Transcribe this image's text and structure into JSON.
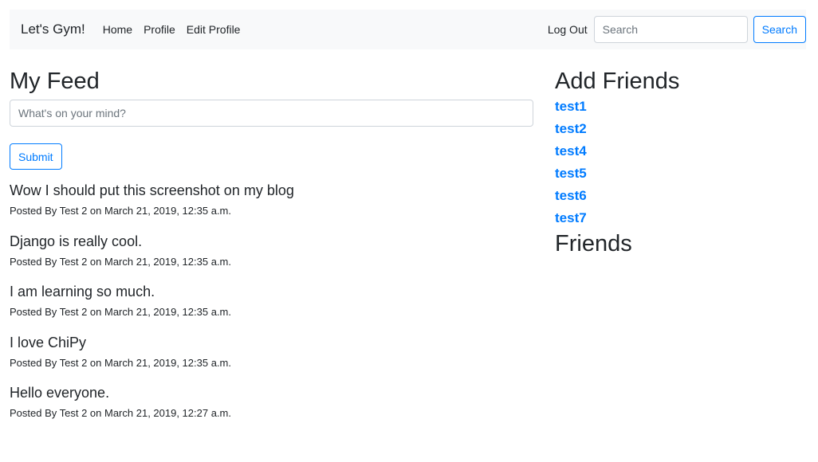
{
  "navbar": {
    "brand": "Let's Gym!",
    "links": [
      "Home",
      "Profile",
      "Edit Profile"
    ],
    "logout": "Log Out",
    "search_placeholder": "Search",
    "search_button": "Search"
  },
  "feed": {
    "title": "My Feed",
    "input_placeholder": "What's on your mind?",
    "submit_label": "Submit",
    "posts": [
      {
        "title": "Wow I should put this screenshot on my blog",
        "meta": "Posted By Test 2 on March 21, 2019, 12:35 a.m."
      },
      {
        "title": "Django is really cool.",
        "meta": "Posted By Test 2 on March 21, 2019, 12:35 a.m."
      },
      {
        "title": "I am learning so much.",
        "meta": "Posted By Test 2 on March 21, 2019, 12:35 a.m."
      },
      {
        "title": "I love ChiPy",
        "meta": "Posted By Test 2 on March 21, 2019, 12:35 a.m."
      },
      {
        "title": "Hello everyone.",
        "meta": "Posted By Test 2 on March 21, 2019, 12:27 a.m."
      }
    ]
  },
  "sidebar": {
    "add_friends_title": "Add Friends",
    "suggestions": [
      "test1",
      "test2",
      "test4",
      "test5",
      "test6",
      "test7"
    ],
    "friends_title": "Friends"
  },
  "colors": {
    "accent": "#007bff",
    "navbar_bg": "#f8f9fa",
    "text": "#212529"
  }
}
